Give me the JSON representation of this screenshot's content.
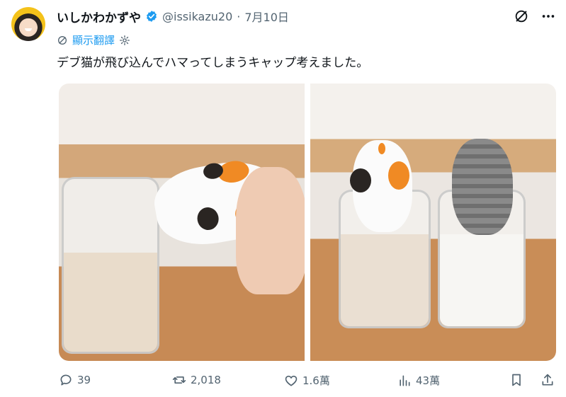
{
  "author": {
    "display_name": "いしかわかずや",
    "handle": "@issikazu20",
    "separator": "·",
    "date": "7月10日"
  },
  "translate_label": "顯示翻譯",
  "tweet_text": "デブ猫が飛び込んでハマってしまうキャップ考えました。",
  "stats": {
    "replies": "39",
    "retweets": "2,018",
    "likes": "1.6萬",
    "views": "43萬"
  },
  "colors": {
    "link": "#1d9bf0",
    "verified": "#1d9bf0",
    "muted": "#536471"
  },
  "icons": {
    "header": [
      "verified-badge-icon",
      "grok-icon",
      "more-icon"
    ],
    "translate": [
      "globe-icon",
      "settings-icon"
    ],
    "actions": [
      "reply-icon",
      "retweet-icon",
      "like-icon",
      "views-icon",
      "bookmark-icon",
      "share-icon"
    ]
  }
}
